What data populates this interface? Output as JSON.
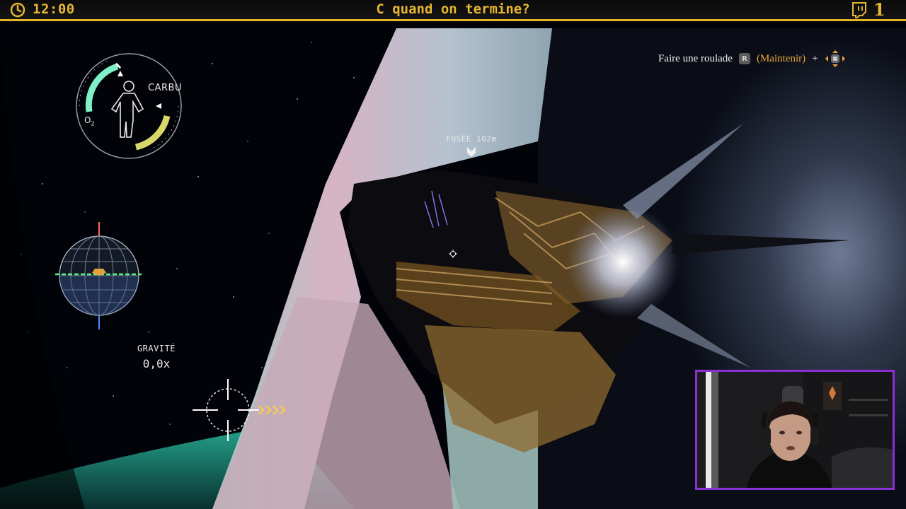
{
  "stream_bar": {
    "time": "12:00",
    "title": "C quand on termine?",
    "viewer_count": "1",
    "accent_color": "#e7b632"
  },
  "hud": {
    "prompt": {
      "action": "Faire une roulade",
      "key": "R",
      "hold": "(Maintenir)",
      "plus": "+"
    },
    "gauge": {
      "fuel_label": "CARBU",
      "oxygen_label": "O",
      "oxygen_subscript": "2",
      "oxygen_color": "#7ff0c8",
      "fuel_color": "#d8d86a"
    },
    "gravity": {
      "label": "GRAVITÉ",
      "value": "0,0x"
    },
    "marker": {
      "label": "FUSÉE 102m"
    }
  },
  "webcam": {
    "border_color": "#8a2fd4"
  }
}
